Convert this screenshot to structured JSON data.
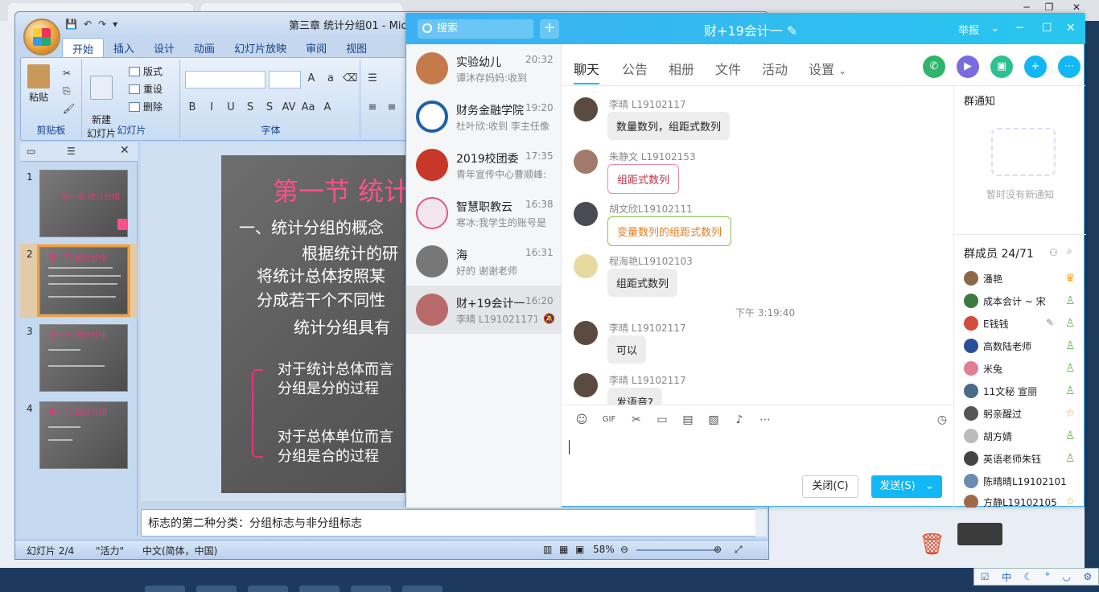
{
  "desktop": {
    "tray_icons": [
      "中",
      "☾",
      "°",
      "◡",
      "⚙"
    ],
    "colors": {
      "taskbar": "#1d3a5e"
    }
  },
  "ppt": {
    "title": "第三章  统计分组01 - Mic",
    "tabs": [
      "开始",
      "插入",
      "设计",
      "动画",
      "幻灯片放映",
      "审阅",
      "视图"
    ],
    "groups": {
      "clipboard": {
        "label": "剪贴板",
        "paste": "粘贴"
      },
      "slides": {
        "label": "幻灯片",
        "new_slide": "新建\n幻灯片",
        "layout": "版式",
        "reset": "重设",
        "delete": "删除"
      },
      "font": {
        "label": "字体"
      }
    },
    "slide_thumbs": [
      {
        "num": "1",
        "title": "第一节  统计分组"
      },
      {
        "num": "2",
        "title": "第一节 统计分组"
      },
      {
        "num": "3",
        "title": "第一节 统计分组"
      },
      {
        "num": "4",
        "title": "第一节 统计分组"
      }
    ],
    "slide": {
      "title": "第一节  统计",
      "heading": "一、统计分组的概念",
      "line1": "根据统计的研",
      "line2": "将统计总体按照某",
      "line3": "分成若干个不同性",
      "line4": "统计分组具有",
      "bullet1a": "对于统计总体而言",
      "bullet1b": "分组是分的过程",
      "bullet2a": "对于总体单位而言",
      "bullet2b": "分组是合的过程"
    },
    "notes": "标志的第二种分类：分组标志与非分组标志",
    "status": {
      "slide": "幻灯片 2/4",
      "theme": "\"活力\"",
      "lang": "中文(简体，中国)",
      "zoom": "58%"
    }
  },
  "qq": {
    "search_placeholder": "搜索",
    "window_title": "财+19会计一",
    "header_right": {
      "report": "举报"
    },
    "conversations": [
      {
        "name": "实验幼儿",
        "time": "20:32",
        "msg": "谭沐存妈妈:收到",
        "color": "#c47a4a"
      },
      {
        "name": "财务金融学院",
        "time": "19:20",
        "msg": "杜叶欣:收到  李主任像",
        "color": "#1e5fa8"
      },
      {
        "name": "2019校团委",
        "time": "17:35",
        "msg": "青年宣传中心曹顺峰:",
        "color": "#c8382a"
      },
      {
        "name": "智慧职教云",
        "time": "16:38",
        "msg": "寒冰:我学生的账号是",
        "color": "#d85b8c"
      },
      {
        "name": "海",
        "time": "16:31",
        "msg": "好的 谢谢老师",
        "color": "#777"
      },
      {
        "name": "财+19会计一",
        "time": "16:20",
        "msg": "李晴  L191021171",
        "color": "#b86a6a"
      }
    ],
    "tabs": [
      "聊天",
      "公告",
      "相册",
      "文件",
      "活动",
      "设置"
    ],
    "messages": [
      {
        "name": "李晴  L19102117",
        "text": "数量数列，组距式数列"
      },
      {
        "name": "朱静文 L19102153",
        "text": "组距式数列"
      },
      {
        "name": "胡文欣L19102111",
        "text": "变量数列的组距式数列"
      },
      {
        "name": "程海艳L19102103",
        "text": "组距式数列"
      },
      {
        "name": "李晴  L19102117",
        "text": "可以"
      },
      {
        "name": "李晴  L19102117",
        "text": "发语音?"
      }
    ],
    "time_divider": "下午 3:19:40",
    "buttons": {
      "close": "关闭(C)",
      "send": "发送(S)"
    },
    "notice": {
      "title": "群通知",
      "empty": "暂时没有新通知"
    },
    "members_title": "群成员 24/71",
    "members": [
      {
        "name": "潘艳",
        "color": "#8b6a4a"
      },
      {
        "name": "成本会计 ~ 宋",
        "color": "#3d7a3d"
      },
      {
        "name": "E钱钱",
        "color": "#d44b3a"
      },
      {
        "name": "高数陆老师",
        "color": "#2a4f9a"
      },
      {
        "name": "米兔",
        "color": "#e08090"
      },
      {
        "name": "11文秘 宣丽",
        "color": "#4a6a8a"
      },
      {
        "name": "躬亲醒过",
        "color": "#555"
      },
      {
        "name": "胡方婧",
        "color": "#bbb"
      },
      {
        "name": "英语老师朱钰",
        "color": "#444"
      },
      {
        "name": "陈晴晴L19102101",
        "color": "#6a8ab0"
      },
      {
        "name": "方静L19102105",
        "color": "#a06a4a"
      }
    ],
    "colors": {
      "accent": "#12b7f5",
      "header": "#3cb0f2"
    }
  }
}
